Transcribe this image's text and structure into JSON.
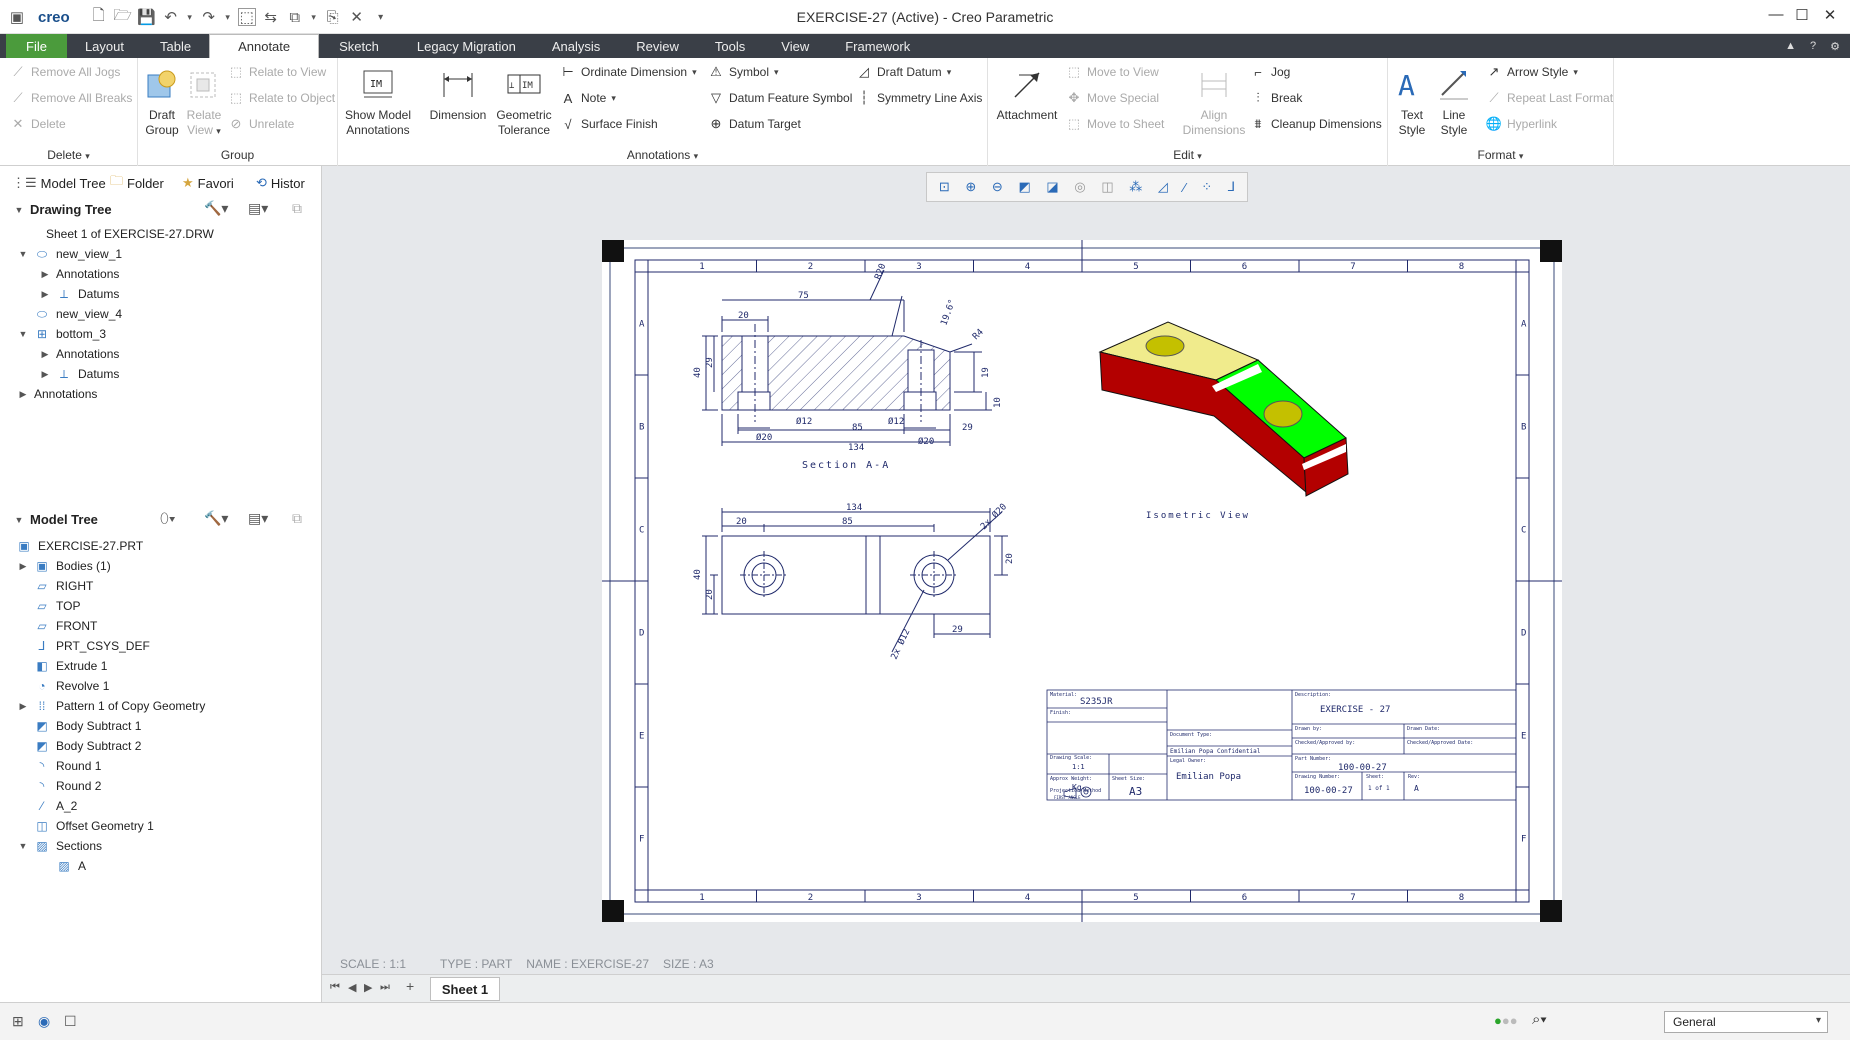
{
  "app": {
    "logo": "creo",
    "window_title": "EXERCISE-27 (Active) - Creo Parametric"
  },
  "menu": {
    "tabs": [
      "File",
      "Layout",
      "Table",
      "Annotate",
      "Sketch",
      "Legacy Migration",
      "Analysis",
      "Review",
      "Tools",
      "View",
      "Framework"
    ],
    "active": "Annotate"
  },
  "ribbon": {
    "delete": {
      "remove_all_jogs": "Remove All Jogs",
      "remove_all_breaks": "Remove All Breaks",
      "delete": "Delete",
      "label": "Delete"
    },
    "group": {
      "draft_group": "Draft Group",
      "relate_view": "Relate View",
      "relate_to_view": "Relate to View",
      "relate_to_object": "Relate to Object",
      "unrelate": "Unrelate",
      "label": "Group"
    },
    "annotations": {
      "show_model_annotations": "Show Model Annotations",
      "dimension": "Dimension",
      "geometric_tolerance": "Geometric Tolerance",
      "ordinate_dimension": "Ordinate Dimension",
      "note": "Note",
      "surface_finish": "Surface Finish",
      "symbol": "Symbol",
      "datum_feature_symbol": "Datum Feature Symbol",
      "datum_target": "Datum Target",
      "draft_datum": "Draft Datum",
      "symmetry_line_axis": "Symmetry Line Axis",
      "label": "Annotations"
    },
    "edit": {
      "attachment": "Attachment",
      "move_to_view": "Move to View",
      "move_special": "Move Special",
      "move_to_sheet": "Move to Sheet",
      "align_dimensions": "Align Dimensions",
      "jog": "Jog",
      "break": "Break",
      "cleanup_dimensions": "Cleanup Dimensions",
      "label": "Edit"
    },
    "format": {
      "text_style": "Text Style",
      "line_style": "Line Style",
      "arrow_style": "Arrow Style",
      "repeat_last_format": "Repeat Last Format",
      "hyperlink": "Hyperlink",
      "label": "Format"
    }
  },
  "panel": {
    "tabs": [
      "Model Tree",
      "Folder",
      "Favori",
      "Histor"
    ],
    "drawing_tree": {
      "title": "Drawing Tree",
      "items": [
        "Sheet 1 of EXERCISE-27.DRW",
        "new_view_1",
        "Annotations",
        "Datums",
        "new_view_4",
        "bottom_3",
        "Annotations",
        "Datums",
        "Annotations"
      ]
    },
    "model_tree": {
      "title": "Model Tree",
      "items": [
        "EXERCISE-27.PRT",
        "Bodies (1)",
        "RIGHT",
        "TOP",
        "FRONT",
        "PRT_CSYS_DEF",
        "Extrude 1",
        "Revolve 1",
        "Pattern 1 of Copy Geometry",
        "Body Subtract 1",
        "Body Subtract 2",
        "Round 1",
        "Round 2",
        "A_2",
        "Offset Geometry 1",
        "Sections",
        "A"
      ]
    }
  },
  "drawing": {
    "section_label": "Section A-A",
    "iso_label": "Isometric View",
    "zone_numbers": [
      "1",
      "2",
      "3",
      "4",
      "5",
      "6",
      "7",
      "8"
    ],
    "zone_letters": [
      "A",
      "B",
      "C",
      "D",
      "E",
      "F"
    ],
    "section_dims": [
      "20",
      "75",
      "R20",
      "19.6°",
      "R4",
      "40",
      "29",
      "19",
      "10",
      "Ø12",
      "Ø12",
      "85",
      "29",
      "Ø20",
      "Ø20",
      "134"
    ],
    "top_dims": [
      "134",
      "20",
      "85",
      "2x Ø20",
      "40",
      "20",
      "20",
      "2x Ø12",
      "29"
    ],
    "title_block": {
      "material_label": "Material:",
      "material": "S235JR",
      "finish_label": "Finish:",
      "description_label": "Description:",
      "description": "EXERCISE - 27",
      "drawn_by": "Drawn by:",
      "drawn_date": "Drawn Date:",
      "checked_by": "Checked/Approved by:",
      "checked_date": "Checked/Approved Date:",
      "part_number_label": "Part Number:",
      "part_number": "100-00-27",
      "drawing_number_label": "Drawing Number:",
      "drawing_number": "100-00-27",
      "sheet_label": "Sheet:",
      "sheet": "1 of 1",
      "rev_label": "Rev:",
      "rev": "A",
      "scale_label": "Drawing Scale:",
      "scale": "1:1",
      "weight_label": "Approx Weight:",
      "weight": "Kg",
      "size_label": "Sheet Size:",
      "size": "A3",
      "projection_label": "Projection Method",
      "projection": "FIRST ANGLE",
      "confidential": "Emilian Popa Confidential",
      "company": "Emilian Popa",
      "document_type": "Document Type:",
      "legal_owner": "Legal Owner:"
    }
  },
  "status": {
    "scale": "SCALE : 1:1",
    "type": "TYPE : PART",
    "name": "NAME : EXERCISE-27",
    "size": "SIZE : A3"
  },
  "sheet_tab": "Sheet 1",
  "filter": "General",
  "colors": {
    "file_tab": "#4b9b3c",
    "menubar": "#3a3f47",
    "iso_top": "#f0eb8c",
    "iso_red": "#b30000",
    "iso_green": "#00ff00",
    "drawing_line": "#202a6b"
  }
}
